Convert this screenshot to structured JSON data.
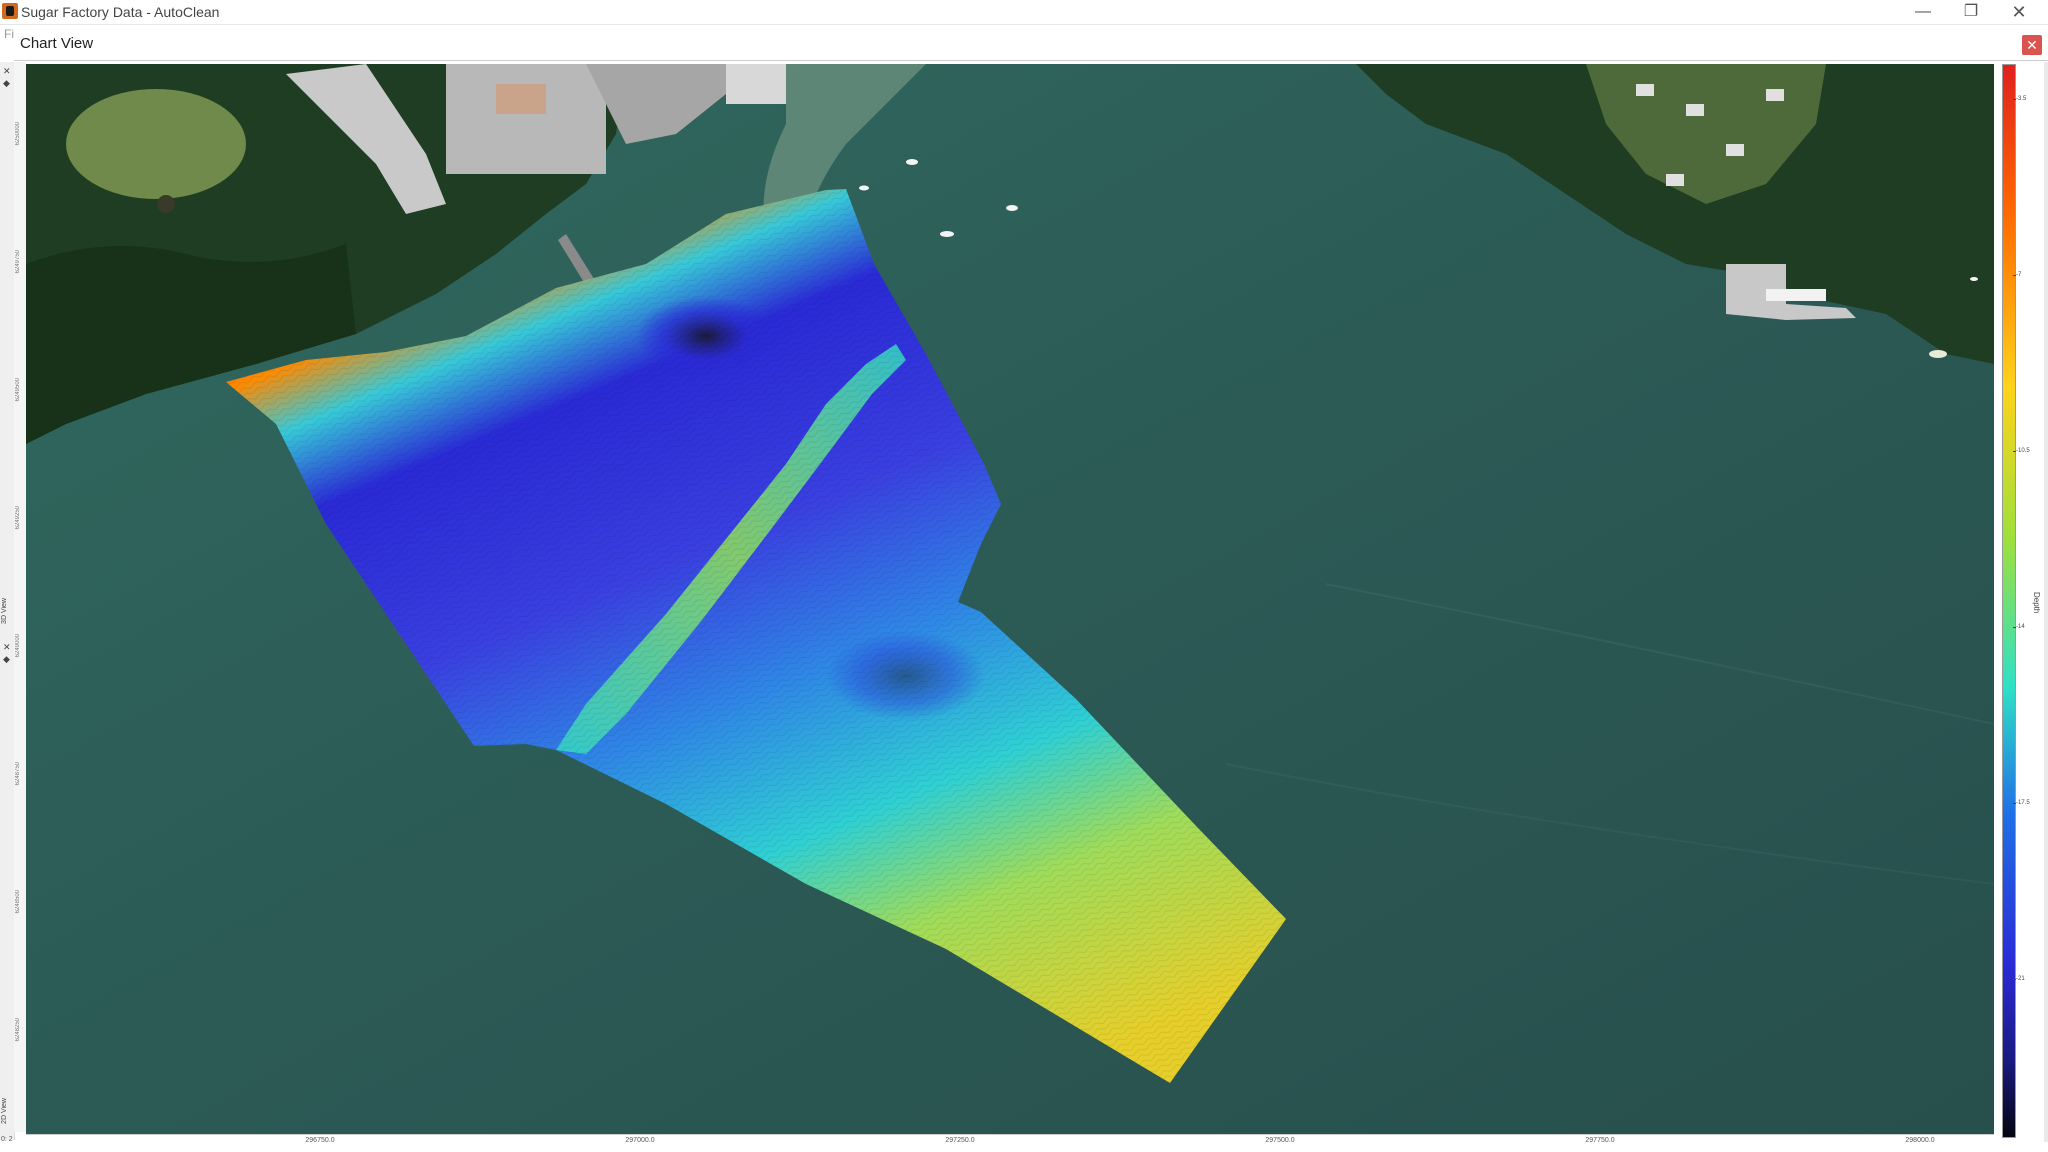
{
  "window": {
    "title": "Sugar Factory Data - AutoClean",
    "minimize_glyph": "—",
    "restore_glyph": "❐",
    "close_glyph": "✕"
  },
  "menu": {
    "stub": "Fi"
  },
  "panel": {
    "title": "Chart View",
    "close_glyph": "✕"
  },
  "left_strip": {
    "close_glyph": "✕",
    "pin_glyph": "◆",
    "label_top": "3D View",
    "close_glyph_2": "✕",
    "pin_glyph_2": "◆",
    "label_bottom": "2D View"
  },
  "y_axis": {
    "ticks": [
      "6250000",
      "6249750",
      "6249500",
      "6249250",
      "6249000",
      "6248750",
      "6248500",
      "6248250"
    ]
  },
  "x_axis": {
    "ticks": [
      "296750.0",
      "297000.0",
      "297250.0",
      "297500.0",
      "297750.0",
      "298000.0"
    ]
  },
  "colorbar": {
    "ticks": [
      "-3.5",
      "-7",
      "-10.5",
      "-14",
      "-17.5",
      "-21"
    ],
    "label": "Depth",
    "colors": [
      "#e0201e",
      "#ff6a00",
      "#ffd21a",
      "#9fe03a",
      "#2fe0c6",
      "#1f6fe6",
      "#2a2ad6",
      "#050510"
    ]
  },
  "map": {
    "water_color": "#2c5a55",
    "land_color": "#1f3d22"
  },
  "status": {
    "corner": "0: 2"
  }
}
